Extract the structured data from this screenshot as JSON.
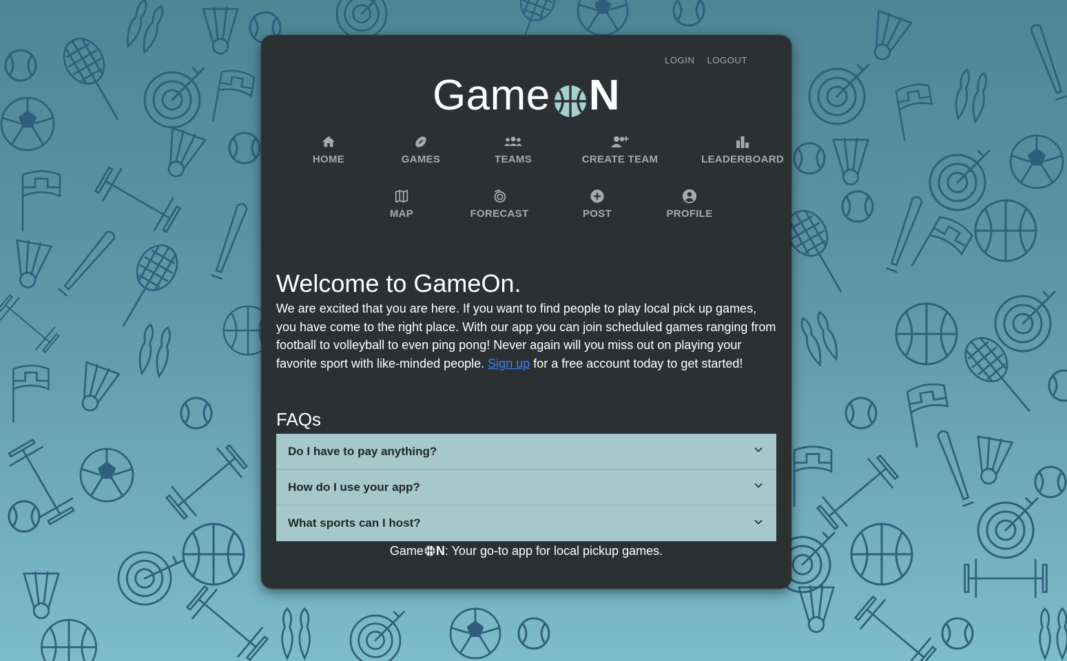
{
  "auth": {
    "login": "LOGIN",
    "logout": "LOGOUT"
  },
  "logo": {
    "prefix": "Game",
    "suffix": "N",
    "ball_icon": "basketball-icon"
  },
  "nav": {
    "row1": [
      {
        "label": "HOME",
        "icon": "home-icon"
      },
      {
        "label": "GAMES",
        "icon": "football-icon"
      },
      {
        "label": "TEAMS",
        "icon": "group-icon"
      },
      {
        "label": "CREATE TEAM",
        "icon": "add-group-icon"
      },
      {
        "label": "LEADERBOARD",
        "icon": "leaderboard-icon"
      }
    ],
    "row2": [
      {
        "label": "MAP",
        "icon": "map-icon"
      },
      {
        "label": "FORECAST",
        "icon": "tornado-icon"
      },
      {
        "label": "POST",
        "icon": "plus-circle-icon"
      },
      {
        "label": "PROFILE",
        "icon": "account-icon"
      }
    ]
  },
  "welcome": {
    "title": "Welcome to GameOn.",
    "body_before": "We are excited that you are here. If you want to find people to play local pick up games, you have come to the right place. With our app you can join scheduled games ranging from football to volleyball to even ping pong! Never again will you miss out on playing your favorite sport with like-minded people.",
    "link_text": "Sign up",
    "body_after": "for a free account today to get started!"
  },
  "faqs": {
    "title": "FAQs",
    "items": [
      {
        "question": "Do I have to pay anything?"
      },
      {
        "question": "How do I use your app?"
      },
      {
        "question": "What sports can I host?"
      }
    ]
  },
  "footer": {
    "brand_prefix": "Game",
    "brand_suffix": "N",
    "tagline": ": Your go-to app for local pickup games."
  },
  "colors": {
    "card_bg": "#2b3133",
    "nav_text": "#a3abae",
    "accent_ball": "#a6d0cc",
    "faq_bg": "#a6c8ca",
    "link": "#3e82f7",
    "background_pattern": "#2f5f7d"
  }
}
